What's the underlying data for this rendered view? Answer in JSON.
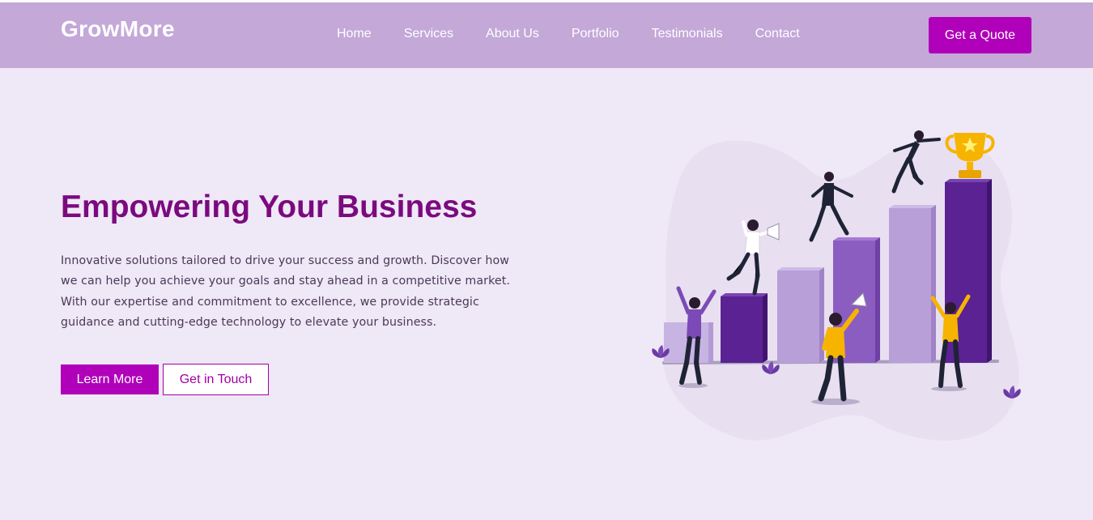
{
  "brand": {
    "name": "GrowMore"
  },
  "nav": {
    "items": [
      {
        "label": "Home"
      },
      {
        "label": "Services"
      },
      {
        "label": "About Us"
      },
      {
        "label": "Portfolio"
      },
      {
        "label": "Testimonials"
      },
      {
        "label": "Contact"
      }
    ],
    "cta_label": "Get a Quote"
  },
  "hero": {
    "title": "Empowering Your Business",
    "description": "Innovative solutions tailored to drive your success and growth. Discover how we can help you achieve your goals and stay ahead in a competitive market. With our expertise and commitment to excellence, we provide strategic guidance and cutting-edge technology to elevate your business.",
    "primary_button": "Learn More",
    "secondary_button": "Get in Touch"
  },
  "colors": {
    "navbar_bg": "#c3a8d8",
    "page_bg": "#efe8f7",
    "accent": "#b000b9",
    "title": "#7b0a7e"
  },
  "illustration": {
    "icon": "business-growth-illustration"
  }
}
